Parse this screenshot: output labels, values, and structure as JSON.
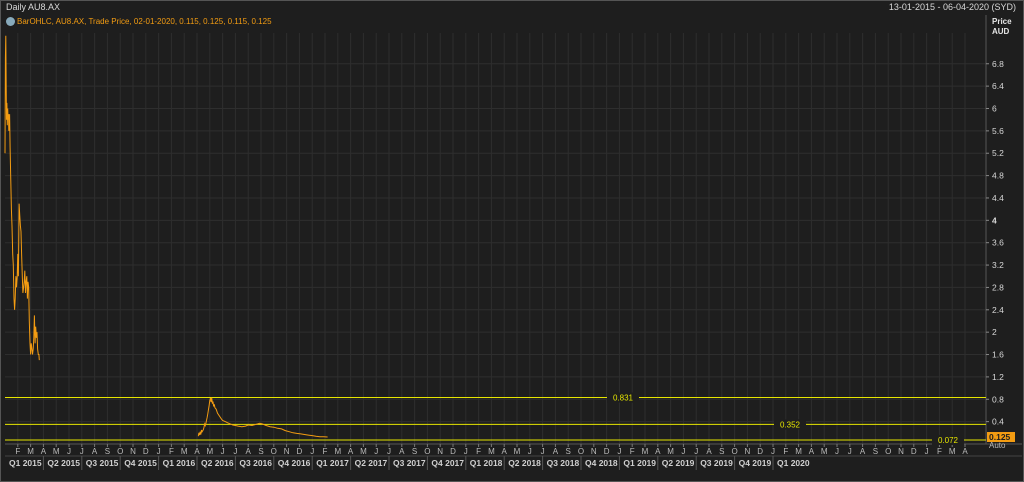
{
  "window": {
    "title": "Daily AU8.AX",
    "date_range": "13-01-2015 - 06-04-2020 (SYD)"
  },
  "legend": {
    "text": "BarOHLC, AU8.AX, Trade Price, 02-01-2020, 0.115, 0.125, 0.115, 0.125"
  },
  "price_axis": {
    "title_line1": "Price",
    "title_line2": "AUD"
  },
  "chart_data": {
    "type": "line",
    "title": "",
    "series": [
      {
        "name": "AU8.AX",
        "color": "#f39c12",
        "segments": [
          [
            [
              0.0,
              5.2
            ],
            [
              0.03,
              6.9
            ],
            [
              0.06,
              7.3
            ],
            [
              0.09,
              6.4
            ],
            [
              0.12,
              5.8
            ],
            [
              0.15,
              6.1
            ],
            [
              0.18,
              5.7
            ],
            [
              0.21,
              6.0
            ],
            [
              0.24,
              5.8
            ],
            [
              0.27,
              5.9
            ],
            [
              0.3,
              5.6
            ],
            [
              0.33,
              5.7
            ],
            [
              0.36,
              5.9
            ],
            [
              0.4,
              5.3
            ],
            [
              0.45,
              4.7
            ],
            [
              0.5,
              4.2
            ],
            [
              0.55,
              3.9
            ],
            [
              0.6,
              3.4
            ],
            [
              0.65,
              3.2
            ],
            [
              0.7,
              2.6
            ],
            [
              0.75,
              2.4
            ],
            [
              0.8,
              2.6
            ],
            [
              0.85,
              3.0
            ],
            [
              0.9,
              2.8
            ],
            [
              0.95,
              3.0
            ],
            [
              1.0,
              3.4
            ],
            [
              1.05,
              3.0
            ],
            [
              1.1,
              4.3
            ],
            [
              1.15,
              4.1
            ],
            [
              1.2,
              3.9
            ],
            [
              1.25,
              3.8
            ],
            [
              1.3,
              3.4
            ],
            [
              1.35,
              3.0
            ],
            [
              1.4,
              2.7
            ],
            [
              1.45,
              2.8
            ],
            [
              1.5,
              2.9
            ],
            [
              1.55,
              3.1
            ],
            [
              1.6,
              2.7
            ],
            [
              1.65,
              2.9
            ],
            [
              1.7,
              3.0
            ],
            [
              1.75,
              2.6
            ],
            [
              1.8,
              2.9
            ],
            [
              1.85,
              2.8
            ],
            [
              1.9,
              2.2
            ],
            [
              1.95,
              1.8
            ],
            [
              2.0,
              1.6
            ],
            [
              2.05,
              1.8
            ],
            [
              2.1,
              1.7
            ],
            [
              2.15,
              1.6
            ],
            [
              2.2,
              1.7
            ],
            [
              2.25,
              1.9
            ],
            [
              2.3,
              2.3
            ],
            [
              2.35,
              1.8
            ],
            [
              2.4,
              2.1
            ],
            [
              2.45,
              1.9
            ],
            [
              2.5,
              2.0
            ],
            [
              2.55,
              1.7
            ],
            [
              2.6,
              1.6
            ],
            [
              2.65,
              1.6
            ],
            [
              2.68,
              1.5
            ]
          ],
          [
            [
              15.1,
              0.14
            ],
            [
              15.15,
              0.2
            ],
            [
              15.2,
              0.16
            ],
            [
              15.25,
              0.22
            ],
            [
              15.3,
              0.17
            ],
            [
              15.35,
              0.25
            ],
            [
              15.4,
              0.22
            ],
            [
              15.45,
              0.24
            ],
            [
              15.5,
              0.26
            ],
            [
              15.55,
              0.3
            ],
            [
              15.6,
              0.36
            ],
            [
              15.65,
              0.33
            ],
            [
              15.7,
              0.38
            ],
            [
              15.75,
              0.43
            ],
            [
              15.8,
              0.48
            ],
            [
              15.85,
              0.55
            ],
            [
              15.9,
              0.62
            ],
            [
              15.95,
              0.7
            ],
            [
              16.0,
              0.78
            ],
            [
              16.05,
              0.82
            ],
            [
              16.1,
              0.75
            ],
            [
              16.15,
              0.83
            ],
            [
              16.2,
              0.72
            ],
            [
              16.25,
              0.76
            ],
            [
              16.3,
              0.67
            ],
            [
              16.35,
              0.71
            ],
            [
              16.4,
              0.65
            ],
            [
              16.5,
              0.62
            ],
            [
              16.6,
              0.55
            ],
            [
              16.75,
              0.5
            ],
            [
              16.9,
              0.45
            ],
            [
              17.0,
              0.42
            ],
            [
              17.2,
              0.4
            ],
            [
              17.4,
              0.38
            ],
            [
              17.6,
              0.36
            ],
            [
              17.8,
              0.34
            ],
            [
              18.0,
              0.33
            ],
            [
              18.2,
              0.32
            ],
            [
              18.5,
              0.31
            ],
            [
              18.8,
              0.32
            ],
            [
              19.0,
              0.34
            ],
            [
              19.3,
              0.33
            ],
            [
              19.6,
              0.35
            ],
            [
              19.9,
              0.37
            ],
            [
              20.1,
              0.36
            ],
            [
              20.4,
              0.33
            ],
            [
              20.7,
              0.31
            ],
            [
              21.0,
              0.3
            ],
            [
              21.3,
              0.28
            ],
            [
              21.6,
              0.27
            ],
            [
              21.9,
              0.24
            ],
            [
              22.2,
              0.22
            ],
            [
              22.5,
              0.2
            ],
            [
              22.8,
              0.19
            ],
            [
              23.1,
              0.18
            ],
            [
              23.4,
              0.17
            ],
            [
              23.7,
              0.16
            ],
            [
              24.0,
              0.15
            ],
            [
              24.3,
              0.14
            ],
            [
              24.6,
              0.13
            ],
            [
              24.9,
              0.13
            ],
            [
              25.2,
              0.125
            ]
          ]
        ]
      }
    ],
    "reference_lines": [
      {
        "value": 0.831,
        "label": "0.831"
      },
      {
        "value": 0.352,
        "label": "0.352"
      },
      {
        "value": 0.072,
        "label": "0.072"
      }
    ],
    "last_price": "0.125",
    "secondary_tag": "Auto",
    "yaxis": {
      "ticks": [
        0.4,
        0.8,
        1.2,
        1.6,
        2,
        2.4,
        2.8,
        3.2,
        3.6,
        4,
        4.4,
        4.8,
        5.2,
        5.6,
        6,
        6.4,
        6.8
      ],
      "tick_labels": [
        "0.4",
        "0.8",
        "1.2",
        "1.6",
        "2",
        "2.4",
        "2.8",
        "3.2",
        "3.6",
        "4",
        "4.4",
        "4.8",
        "5.2",
        "5.6",
        "6",
        "6.4",
        "6.8"
      ],
      "bold_tick": "4",
      "ylim": [
        0,
        7.35
      ]
    },
    "xaxis": {
      "months": [
        "F",
        "M",
        "A",
        "M",
        "J",
        "J",
        "A",
        "S",
        "O",
        "N",
        "D",
        "J",
        "F",
        "M",
        "A",
        "M",
        "J",
        "J",
        "A",
        "S",
        "O",
        "N",
        "D",
        "J",
        "F",
        "M",
        "A",
        "M",
        "J",
        "J",
        "A",
        "S",
        "O",
        "N",
        "D",
        "J",
        "F",
        "M",
        "A",
        "M",
        "J",
        "J",
        "A",
        "S",
        "O",
        "N",
        "D",
        "J",
        "F",
        "M",
        "A",
        "M",
        "J",
        "J",
        "A",
        "S",
        "O",
        "N",
        "D",
        "J",
        "F",
        "M",
        "A",
        "M",
        "J",
        "J",
        "A",
        "S",
        "O",
        "N",
        "D",
        "J",
        "F",
        "M",
        "A"
      ],
      "quarters": [
        "Q1 2015",
        "Q2 2015",
        "Q3 2015",
        "Q4 2015",
        "Q1 2016",
        "Q2 2016",
        "Q3 2016",
        "Q4 2016",
        "Q1 2017",
        "Q2 2017",
        "Q3 2017",
        "Q4 2017",
        "Q1 2018",
        "Q2 2018",
        "Q3 2018",
        "Q4 2018",
        "Q1 2019",
        "Q2 2019",
        "Q3 2019",
        "Q4 2019",
        "Q1 2020"
      ]
    },
    "grid": true,
    "colors": {
      "series": "#f39c12",
      "reference": "#e6e600",
      "grid": "#2e2e2e",
      "axis_text": "#d8d8d8"
    }
  }
}
